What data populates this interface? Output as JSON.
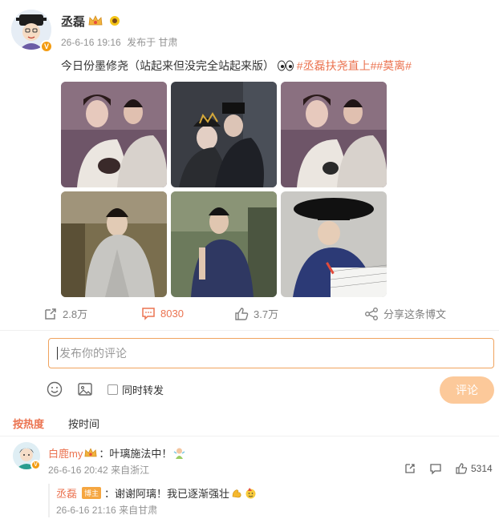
{
  "post": {
    "author": "丞磊",
    "date": "26-6-16 19:16",
    "location": "发布于 甘肃",
    "text": "今日份墨修尧（站起来但没完全站起来版）",
    "hashtags": "#丞磊扶尧直上##莫离#",
    "images": [
      "photo-1",
      "photo-2",
      "photo-3",
      "photo-4",
      "photo-5",
      "photo-6"
    ]
  },
  "actions": {
    "forward": "2.8万",
    "comments": "8030",
    "likes": "3.7万",
    "share": "分享这条博文"
  },
  "composer": {
    "placeholder": "发布你的评论",
    "forward_label": "同时转发",
    "submit_label": "评论"
  },
  "sort": {
    "hot": "按热度",
    "time": "按时间"
  },
  "comment": {
    "user": "白鹿my",
    "text": "：叶璃施法中！",
    "date": "26-6-16 20:42",
    "location": "来自浙江",
    "likes": "5314"
  },
  "reply": {
    "user": "丞磊",
    "badge": "博主",
    "text": "：谢谢阿璃！我已逐渐强壮",
    "date": "26-6-16 21:16",
    "location": "来自甘肃"
  },
  "colors": {
    "accent": "#eb7350",
    "submit_bg": "#fcc99a",
    "input_border": "#f0a35e",
    "meta_gray": "#939393"
  }
}
